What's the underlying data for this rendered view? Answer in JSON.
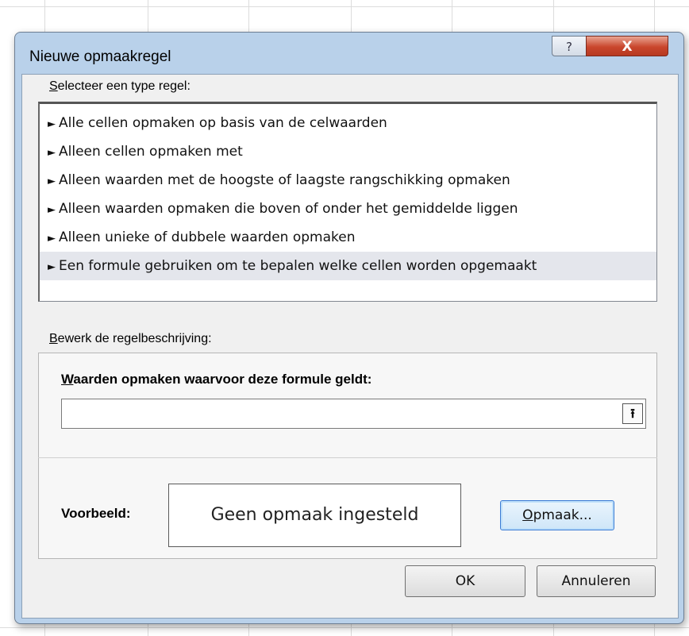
{
  "dialog": {
    "title": "Nieuwe opmaakregel",
    "help_glyph": "?",
    "close_glyph": "X",
    "select_type_label_first": "S",
    "select_type_label_rest": "electeer een type regel:",
    "rule_types": [
      "Alle cellen opmaken op basis van de celwaarden",
      "Alleen cellen opmaken met",
      "Alleen waarden met de hoogste of laagste rangschikking opmaken",
      "Alleen waarden opmaken die boven of onder het gemiddelde liggen",
      "Alleen unieke of dubbele waarden opmaken",
      "Een formule gebruiken om te bepalen welke cellen worden opgemaakt"
    ],
    "selected_index": 5,
    "edit_label_first": "B",
    "edit_label_rest": "ewerk de regelbeschrijving:",
    "formula_label_first": "W",
    "formula_label_rest": "aarden opmaken waarvoor deze formule geldt:",
    "formula_value": "",
    "preview_label": "Voorbeeld:",
    "preview_text": "Geen opmaak ingesteld",
    "format_button_first": "O",
    "format_button_rest": "pmaak...",
    "ok_label": "OK",
    "cancel_label": "Annuleren"
  },
  "colors": {
    "frame": "#b9d1ea",
    "close": "#c9462c",
    "selected_row": "#e4e6ec"
  }
}
